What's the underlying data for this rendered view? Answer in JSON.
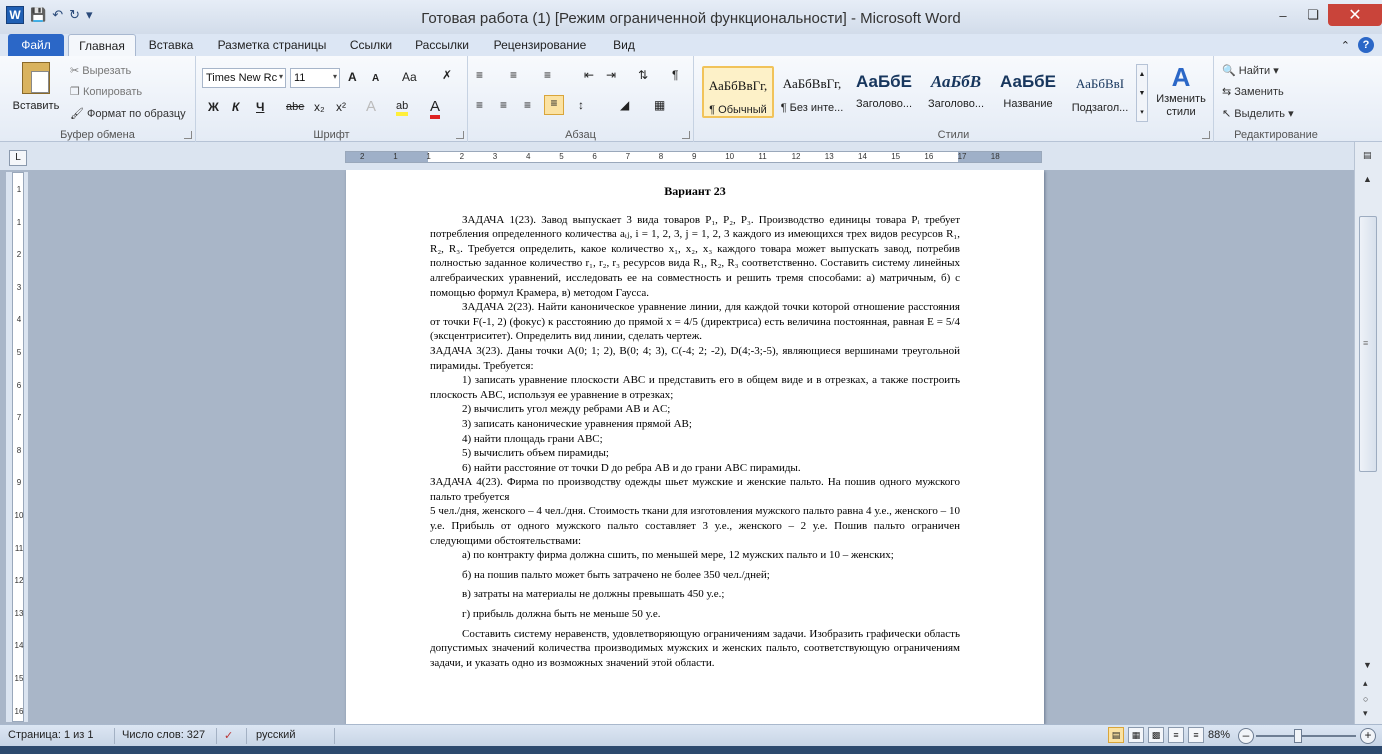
{
  "window": {
    "title": "Готовая работа (1) [Режим ограниченной функциональности]  -  Microsoft Word",
    "app_icon": "W"
  },
  "tabs": [
    "Файл",
    "Главная",
    "Вставка",
    "Разметка страницы",
    "Ссылки",
    "Рассылки",
    "Рецензирование",
    "Вид"
  ],
  "active_tab": "Главная",
  "ribbon": {
    "clipboard": {
      "paste": "Вставить",
      "cut": "Вырезать",
      "copy": "Копировать",
      "format_painter": "Формат по образцу",
      "label": "Буфер обмена"
    },
    "font": {
      "name": "Times New Rc",
      "size": "11",
      "label": "Шрифт",
      "bold": "Ж",
      "italic": "К",
      "underline": "Ч",
      "strike": "abe",
      "sub": "x₂",
      "sup": "x²",
      "grow": "A",
      "shrink": "A",
      "case": "Aa"
    },
    "paragraph": {
      "label": "Абзац"
    },
    "styles": {
      "label": "Стили",
      "items": [
        {
          "preview": "АаБбВвГг,",
          "name": "¶ Обычный"
        },
        {
          "preview": "АаБбВвГг,",
          "name": "¶ Без инте..."
        },
        {
          "preview": "АаБбЕ",
          "name": "Заголово..."
        },
        {
          "preview": "АаБбВ",
          "name": "Заголово..."
        },
        {
          "preview": "АаБбЕ",
          "name": "Название"
        },
        {
          "preview": "АаБбВвІ",
          "name": "Подзагол..."
        }
      ],
      "change": "Изменить стили"
    },
    "editing": {
      "find": "Найти",
      "replace": "Заменить",
      "select": "Выделить",
      "label": "Редактирование"
    }
  },
  "ruler": {
    "h_numbers": [
      "2",
      "1",
      "1",
      "2",
      "3",
      "4",
      "5",
      "6",
      "7",
      "8",
      "9",
      "10",
      "11",
      "12",
      "13",
      "14",
      "15",
      "16",
      "17",
      "18"
    ],
    "v_numbers": [
      "1",
      "1",
      "2",
      "3",
      "4",
      "5",
      "6",
      "7",
      "8",
      "9",
      "10",
      "11",
      "12",
      "13",
      "14",
      "15",
      "16"
    ]
  },
  "document": {
    "heading": "Вариант 23",
    "paragraphs": [
      "ЗАДАЧА 1(23). Завод выпускает 3 вида товаров P₁, P₂, P₃. Производство единицы товара Pᵢ требует потребления определенного количества aᵢⱼ, i = 1, 2, 3, j = 1, 2, 3 каждого из имеющихся трех видов ресурсов R₁, R₂, R₃. Требуется определить, какое количество x₁, x₂, x₃ каждого товара может выпускать завод, потребив полностью заданное количество r₁, r₂, r₃ ресурсов вида  R₁, R₂, R₃ соответственно. Составить систему линейных алгебраических уравнений, исследовать ее на совместность и решить тремя способами: а) матричным, б) с помощью формул Крамера, в) методом Гаусса.",
      "ЗАДАЧА 2(23). Найти каноническое уравнение линии, для каждой точки которой отношение расстояния от точки F(-1, 2) (фокус) к расстоянию до прямой x = 4/5 (директриса) есть величина постоянная, равная E = 5/4 (эксцентриситет). Определить вид линии, сделать чертеж.",
      "ЗАДАЧА 3(23). Даны точки A(0; 1; 2), B(0; 4; 3), C(-4; 2; -2), D(4;-3;-5), являющиеся вершинами треугольной пирамиды. Требуется:",
      "1) записать уравнение плоскости ABC и представить его в общем виде и в отрезках, а также построить плоскость ABC, используя ее уравнение в отрезках;",
      "2) вычислить угол между ребрами AB и AC;",
      "3) записать канонические уравнения прямой AB;",
      "4) найти площадь грани ABC;",
      "5) вычислить объем пирамиды;",
      "6) найти расстояние от точки D до ребра AB и до грани ABC пирамиды.",
      "ЗАДАЧА 4(23). Фирма по производству одежды шьет мужские и женские пальто. На пошив одного мужского пальто требуется",
      "5 чел./дня, женского – 4 чел./дня. Стоимость ткани для изготовления мужского пальто равна 4 у.е., женского – 10 у.е. Прибыль от одного мужского пальто составляет 3 у.е., женского – 2 у.е. Пошив пальто ограничен следующими обстоятельствами:",
      "а) по контракту фирма должна сшить, по меньшей мере, 12 мужских пальто и 10 – женских;",
      "б) на пошив пальто может быть затрачено не более 350 чел./дней;",
      "в) затраты на материалы не должны превышать 450 у.е.;",
      "г) прибыль должна быть не меньше 50 у.е.",
      "Составить систему неравенств, удовлетворяющую ограничениям задачи. Изобразить графически область допустимых значений количества производимых мужских и женских пальто, соответствующую ограничениям задачи, и указать одно из возможных значений этой области."
    ]
  },
  "status": {
    "page": "Страница: 1 из 1",
    "words": "Число слов: 327",
    "language": "русский",
    "zoom": "88%"
  }
}
